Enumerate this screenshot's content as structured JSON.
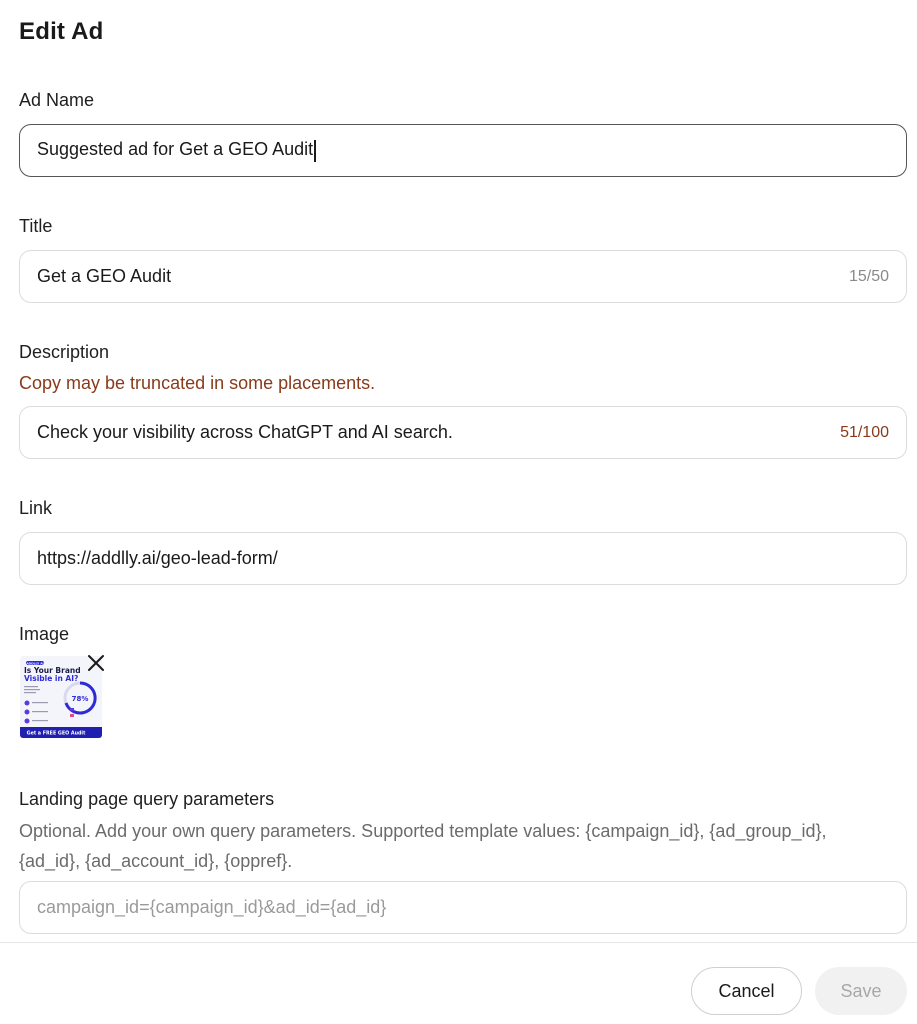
{
  "dialog": {
    "title": "Edit Ad"
  },
  "ad_name": {
    "label": "Ad Name",
    "value": "Suggested ad for Get a GEO Audit"
  },
  "title_field": {
    "label": "Title",
    "value": "Get a GEO Audit",
    "counter": "15/50"
  },
  "description": {
    "label": "Description",
    "warning": "Copy may be truncated in some placements.",
    "value": "Check your visibility across ChatGPT and AI search.",
    "counter": "51/100"
  },
  "link": {
    "label": "Link",
    "value": "https://addlly.ai/geo-lead-form/"
  },
  "image": {
    "label": "Image",
    "thumbnail": {
      "brand": "ADDLLY AI",
      "headline_1": "Is Your Brand",
      "headline_2": "Visible in AI?",
      "stat": "78%",
      "cta": "Get a FREE GEO Audit"
    },
    "remove_icon": "close-icon"
  },
  "query_params": {
    "label": "Landing page query parameters",
    "help": "Optional. Add your own query parameters. Supported template values: {campaign_id}, {ad_group_id}, {ad_id}, {ad_account_id}, {oppref}.",
    "placeholder": "campaign_id={campaign_id}&ad_id={ad_id}"
  },
  "footer": {
    "cancel_label": "Cancel",
    "save_label": "Save"
  }
}
